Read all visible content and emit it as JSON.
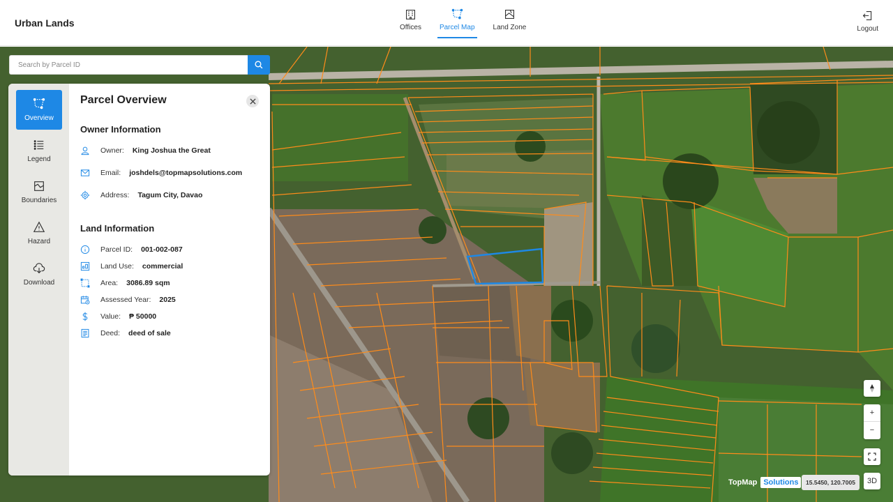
{
  "app": {
    "title": "Urban Lands"
  },
  "nav": {
    "offices": "Offices",
    "parcel_map": "Parcel Map",
    "land_zone": "Land Zone",
    "logout": "Logout",
    "active": "Parcel Map"
  },
  "search": {
    "placeholder": "Search by Parcel ID"
  },
  "sidebar": {
    "items": [
      {
        "label": "Overview",
        "icon": "polygon-icon",
        "active": true
      },
      {
        "label": "Legend",
        "icon": "list-icon",
        "active": false
      },
      {
        "label": "Boundaries",
        "icon": "map-icon",
        "active": false
      },
      {
        "label": "Hazard",
        "icon": "warning-icon",
        "active": false
      },
      {
        "label": "Download",
        "icon": "cloud-download-icon",
        "active": false
      }
    ]
  },
  "panel": {
    "title": "Parcel Overview",
    "owner_section": "Owner Information",
    "owner": {
      "label": "Owner:",
      "value": "King Joshua the Great"
    },
    "email": {
      "label": "Email:",
      "value": "joshdels@topmapsolutions.com"
    },
    "address": {
      "label": "Address:",
      "value": "Tagum City, Davao"
    },
    "land_section": "Land Information",
    "parcel_id": {
      "label": "Parcel ID:",
      "value": "001-002-087"
    },
    "land_use": {
      "label": "Land Use:",
      "value": "commercial"
    },
    "area": {
      "label": "Area:",
      "value": "3086.89 sqm"
    },
    "assessed_year": {
      "label": "Assessed Year:",
      "value": "2025"
    },
    "value": {
      "label": "Value:",
      "value": "₱ 50000"
    },
    "deed": {
      "label": "Deed:",
      "value": "deed of sale"
    }
  },
  "map": {
    "controls": {
      "zoom_in": "+",
      "zoom_out": "−",
      "mode_3d": "3D"
    },
    "brand": {
      "name": "TopMap",
      "suffix": "Solutions"
    },
    "coordinates": "15.5450, 120.7005",
    "colors": {
      "parcel_outline": "#ff8c1a",
      "selected_parcel": "#1e88e5",
      "accent": "#1e88e5"
    }
  }
}
